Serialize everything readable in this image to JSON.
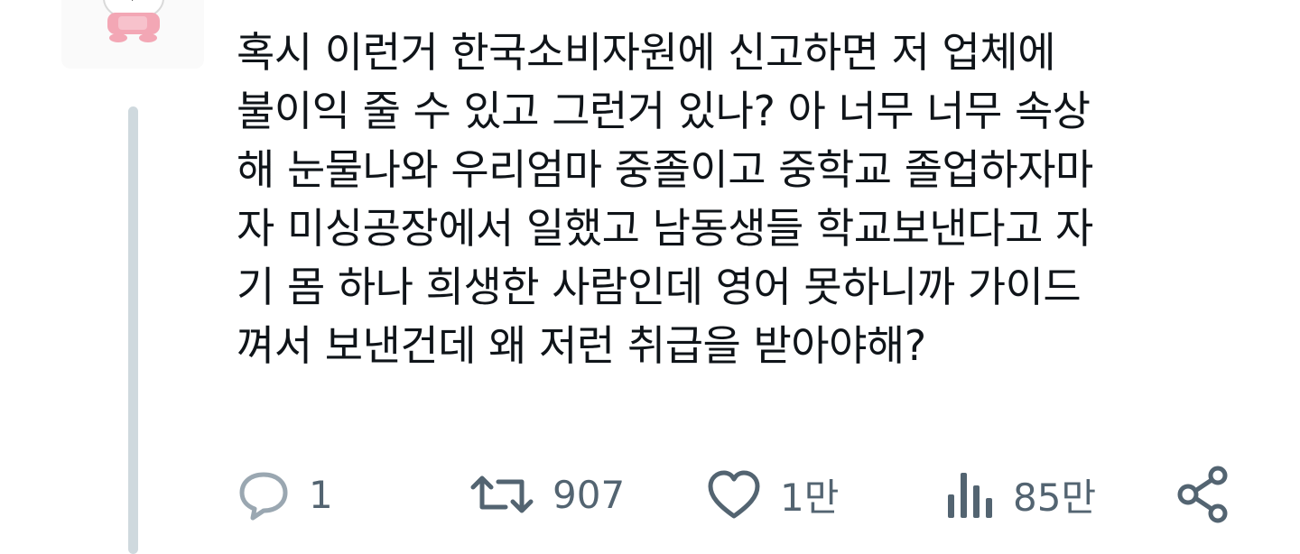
{
  "tweet": {
    "text": "혹시 이런거 한국소비자원에 신고하면 저 업체에\n불이익 줄 수 있고 그런거 있나? 아 너무 너무 속상\n해 눈물나와 우리엄마 중졸이고 중학교 졸업하자마\n자 미싱공장에서 일했고 남동생들 학교보낸다고 자\n기 몸 하나 희생한 사람인데 영어 못하니까 가이드\n껴서 보낸건데 왜 저런 취급을 받아야해?"
  },
  "actions": {
    "reply": {
      "icon": "reply-icon",
      "count": "1"
    },
    "retweet": {
      "icon": "retweet-icon",
      "count": "907"
    },
    "like": {
      "icon": "heart-icon",
      "count": "1만"
    },
    "views": {
      "icon": "views-icon",
      "count": "85만"
    },
    "share": {
      "icon": "share-icon"
    }
  },
  "colors": {
    "text": "#0f1419",
    "secondary": "#536471",
    "thread_line": "#cfd9de"
  }
}
